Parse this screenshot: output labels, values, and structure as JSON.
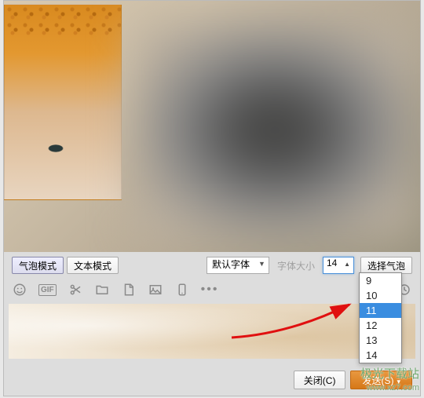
{
  "modes": {
    "bubble": "气泡模式",
    "text": "文本模式"
  },
  "font": {
    "default_option": "默认字体",
    "size_label": "字体大小",
    "current_size": "14"
  },
  "bubble_select": "选择气泡",
  "size_options": [
    "9",
    "10",
    "11",
    "12",
    "13",
    "14"
  ],
  "size_highlight": "11",
  "icons": {
    "gif": "GIF"
  },
  "buttons": {
    "close": "关闭(C)",
    "send": "发送(S)"
  },
  "watermark": {
    "line1": "极光下载站",
    "line2": "www.xz7.com"
  }
}
